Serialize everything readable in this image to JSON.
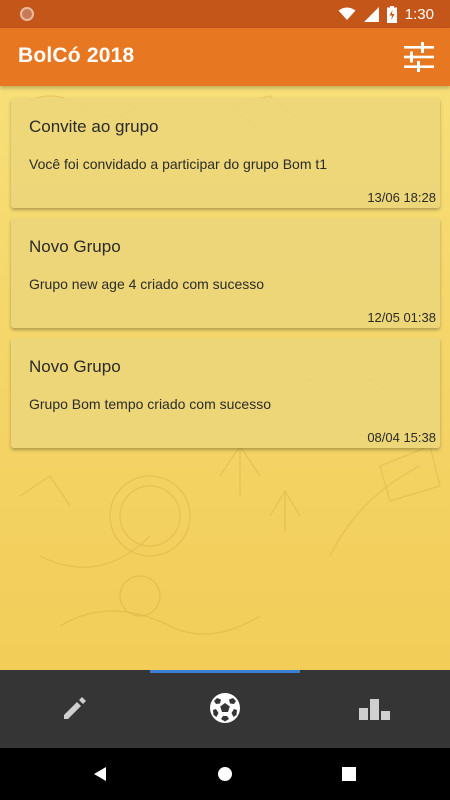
{
  "status_bar": {
    "time": "1:30",
    "icons": [
      "notification-dot-icon",
      "wifi-icon",
      "signal-icon",
      "battery-charging-icon"
    ]
  },
  "app_bar": {
    "title": "BolCó 2018",
    "filter_icon": "tune-sliders-icon"
  },
  "notifications": [
    {
      "title": "Convite ao grupo",
      "message": "Você foi convidado a participar do grupo Bom t1",
      "time": "13/06 18:28"
    },
    {
      "title": "Novo Grupo",
      "message": "Grupo new age 4 criado com sucesso",
      "time": "12/05 01:38"
    },
    {
      "title": "Novo Grupo",
      "message": "Grupo Bom tempo criado com sucesso",
      "time": "08/04 15:38"
    }
  ],
  "bottom_nav": {
    "items": [
      {
        "icon": "pencil-icon",
        "active": false
      },
      {
        "icon": "soccer-ball-icon",
        "active": true
      },
      {
        "icon": "podium-icon",
        "active": false
      }
    ]
  },
  "colors": {
    "status_bar": "#c4561a",
    "app_bar": "#e87722",
    "background": "#f4d66a",
    "card": "#ecd67a",
    "bottom_nav": "#353535",
    "active_indicator": "#3b7fd4"
  },
  "system_nav": {
    "icons": [
      "back-icon",
      "home-icon",
      "recents-icon"
    ]
  }
}
